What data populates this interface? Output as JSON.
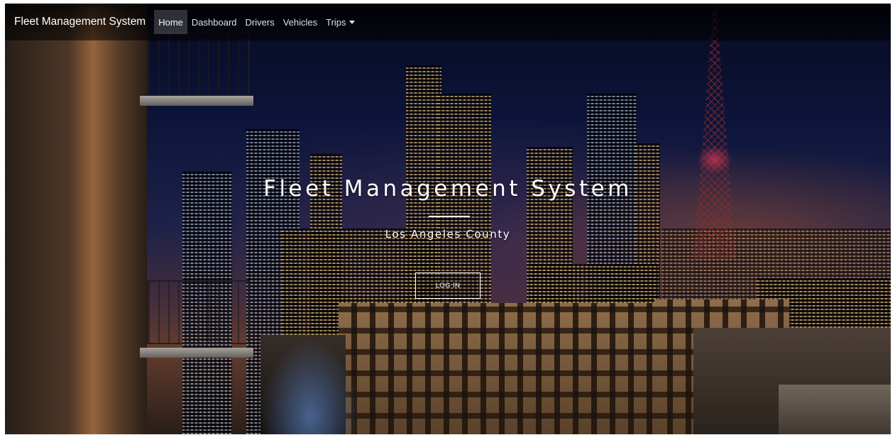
{
  "navbar": {
    "brand": "Fleet Management System",
    "items": [
      {
        "label": "Home",
        "active": true
      },
      {
        "label": "Dashboard",
        "active": false
      },
      {
        "label": "Drivers",
        "active": false
      },
      {
        "label": "Vehicles",
        "active": false
      },
      {
        "label": "Trips",
        "active": false,
        "dropdown": true
      }
    ]
  },
  "hero": {
    "title": "Fleet Management System",
    "subtitle": "Los Angeles County",
    "login_label": "LOG IN",
    "background": "night-city-skyline"
  },
  "colors": {
    "navbar_bg": "#000000",
    "text": "#ffffff",
    "active_item_bg": "#ffffff2e"
  }
}
